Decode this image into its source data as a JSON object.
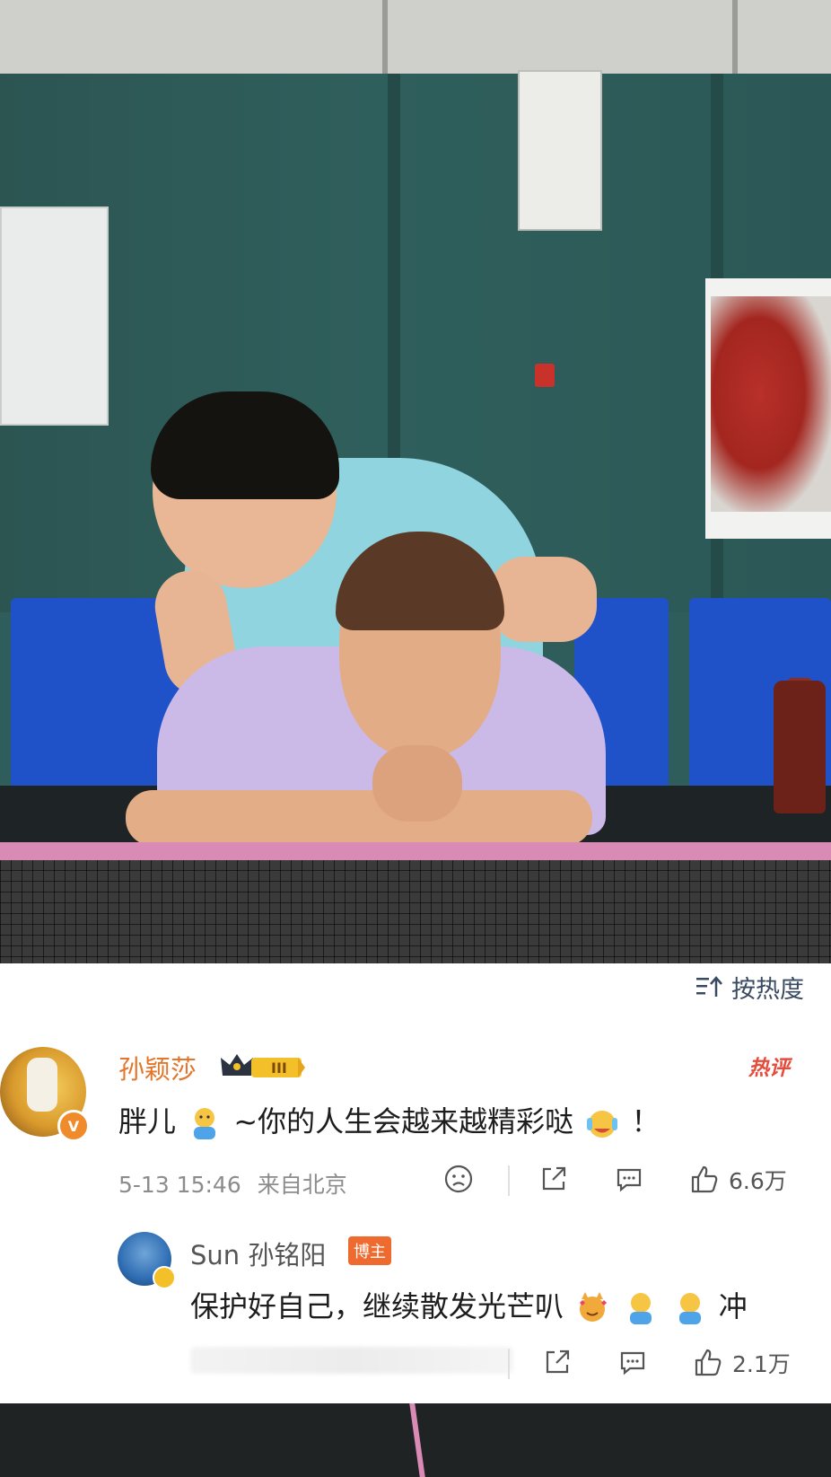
{
  "sort": {
    "label": "按热度",
    "icon": "sort-up-icon"
  },
  "comment": {
    "author": "孙颖莎",
    "level_badge": "III",
    "hot_label": "热评",
    "text_before": "胖儿",
    "text_middle": "~你的人生会越来越精彩哒",
    "text_after": "！",
    "timestamp": "5-13 15:46",
    "location": "来自北京",
    "likes": "6.6万"
  },
  "reply": {
    "author": "Sun 孙铭阳",
    "tag": "博主",
    "text_before": "保护好自己，继续散发光芒叭",
    "text_after": "冲",
    "likes": "2.1万"
  },
  "colors": {
    "author": "#e2762b",
    "hot": "#e74b3c",
    "tag": "#ee6a2e",
    "pink_net": "#d98ab5"
  }
}
